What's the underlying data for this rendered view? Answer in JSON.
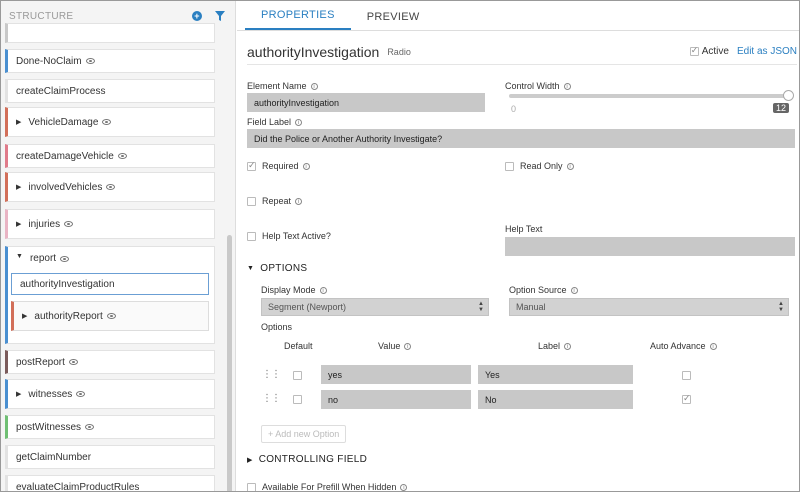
{
  "left_panel": {
    "title": "STRUCTURE",
    "nodes": [
      {
        "label": "",
        "color": "#c8c8c8"
      },
      {
        "label": "Done-NoClaim",
        "color": "#4a8fd0"
      },
      {
        "label": "createClaimProcess",
        "color": "#e2e2e2"
      },
      {
        "label": "VehicleDamage",
        "color": "#d26f59"
      },
      {
        "label": "createDamageVehicle",
        "color": "#e07b8a"
      },
      {
        "label": "involvedVehicles",
        "color": "#d26f59"
      },
      {
        "label": "injuries",
        "color": "#e9b4c4"
      },
      {
        "label": "report",
        "color": "#4a8fd0"
      },
      {
        "label": "postReport",
        "color": "#7a5a5a"
      },
      {
        "label": "witnesses",
        "color": "#4a8fd0"
      },
      {
        "label": "postWitnesses",
        "color": "#6fbf73"
      },
      {
        "label": "getClaimNumber",
        "color": "#e2e2e2"
      },
      {
        "label": "evaluateClaimProductRules",
        "color": "#e2e2e2"
      }
    ],
    "selected_child": "authorityInvestigation",
    "sub_child": "authorityReport"
  },
  "tabs": [
    {
      "label": "PROPERTIES"
    },
    {
      "label": "PREVIEW"
    }
  ],
  "element": {
    "name": "authorityInvestigation",
    "type": "Radio",
    "active_label": "Active",
    "edit_json_label": "Edit as JSON"
  },
  "form": {
    "element_name_label": "Element Name",
    "element_name_value": "authorityInvestigation",
    "control_width_label": "Control Width",
    "slider_min": "0",
    "slider_value": "12",
    "field_label_label": "Field Label",
    "field_label_value": "Did the Police or Another Authority Investigate?",
    "required_label": "Required",
    "read_only_label": "Read Only",
    "repeat_label": "Repeat",
    "help_text_active_label": "Help Text Active?",
    "help_text_label": "Help Text"
  },
  "options": {
    "section_label": "OPTIONS",
    "display_mode_label": "Display Mode",
    "display_mode_value": "Segment (Newport)",
    "option_source_label": "Option Source",
    "option_source_value": "Manual",
    "options_label": "Options",
    "col_default": "Default",
    "col_value": "Value",
    "col_label": "Label",
    "col_auto_advance": "Auto Advance",
    "rows": [
      {
        "value": "yes",
        "label": "Yes",
        "auto_advance": false
      },
      {
        "value": "no",
        "label": "No",
        "auto_advance": true
      }
    ],
    "add_option_label": "+ Add new Option"
  },
  "controlling": {
    "section_label": "CONTROLLING FIELD",
    "prefill_label": "Available For Prefill When Hidden"
  },
  "colors": {
    "accent": "#2a7fc1",
    "input_bg": "#c8c8c8"
  }
}
